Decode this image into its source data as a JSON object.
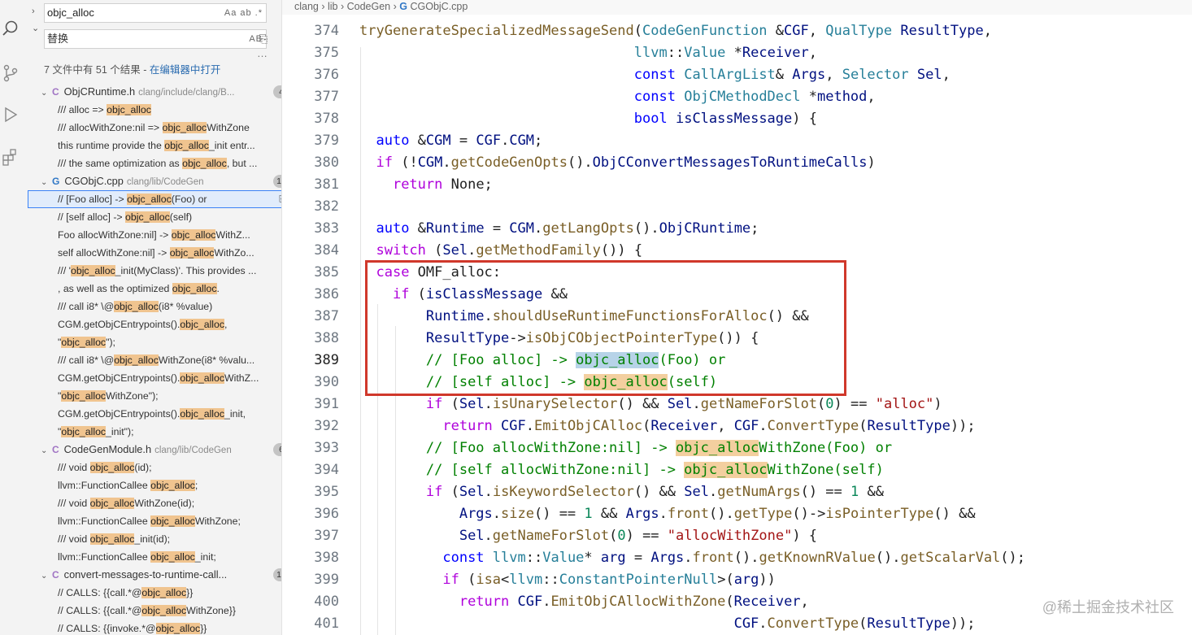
{
  "search": {
    "query": "objc_alloc",
    "replace_placeholder": "替换",
    "opts": "Aa ab .*",
    "replace_opt": "AB"
  },
  "summary": {
    "text": "7 文件中有 51 个结果 - ",
    "link": "在编辑器中打开"
  },
  "breadcrumb": [
    "clang",
    "lib",
    "CodeGen",
    "CGObjC.cpp"
  ],
  "results": [
    {
      "kind": "file",
      "icon": "C",
      "name": "ObjCRuntime.h",
      "path": "clang/include/clang/B...",
      "count": "4"
    },
    {
      "kind": "match",
      "pre": "///   alloc => ",
      "hit": "objc_alloc",
      "post": ""
    },
    {
      "kind": "match",
      "pre": "///   allocWithZone:nil => ",
      "hit": "objc_alloc",
      "post": "WithZone"
    },
    {
      "kind": "match",
      "pre": "this runtime provide the ",
      "hit": "objc_alloc",
      "post": "_init entr..."
    },
    {
      "kind": "match",
      "pre": "/// the same optimization as ",
      "hit": "objc_alloc",
      "post": ", but ..."
    },
    {
      "kind": "file",
      "icon": "G",
      "name": "CGObjC.cpp",
      "path": "clang/lib/CodeGen",
      "count": "14"
    },
    {
      "kind": "match",
      "selected": true,
      "pre": "// [Foo alloc] -> ",
      "hit": "objc_alloc",
      "post": "(Foo) or"
    },
    {
      "kind": "match",
      "pre": "// [self alloc] -> ",
      "hit": "objc_alloc",
      "post": "(self)"
    },
    {
      "kind": "match",
      "pre": "Foo allocWithZone:nil] -> ",
      "hit": "objc_alloc",
      "post": "WithZ..."
    },
    {
      "kind": "match",
      "pre": "self allocWithZone:nil] -> ",
      "hit": "objc_alloc",
      "post": "WithZo..."
    },
    {
      "kind": "match",
      "pre": "/// '",
      "hit": "objc_alloc",
      "post": "_init(MyClass)'. This provides ..."
    },
    {
      "kind": "match",
      "pre": ", as well as the optimized ",
      "hit": "objc_alloc",
      "post": "."
    },
    {
      "kind": "match",
      "pre": "///    call i8* \\@",
      "hit": "objc_alloc",
      "post": "(i8* %value)"
    },
    {
      "kind": "match",
      "pre": "CGM.getObjCEntrypoints().",
      "hit": "objc_alloc",
      "post": ","
    },
    {
      "kind": "match",
      "pre": "\"",
      "hit": "objc_alloc",
      "post": "\");"
    },
    {
      "kind": "match",
      "pre": "///    call i8* \\@",
      "hit": "objc_alloc",
      "post": "WithZone(i8* %valu..."
    },
    {
      "kind": "match",
      "pre": "CGM.getObjCEntrypoints().",
      "hit": "objc_alloc",
      "post": "WithZ..."
    },
    {
      "kind": "match",
      "pre": "\"",
      "hit": "objc_alloc",
      "post": "WithZone\");"
    },
    {
      "kind": "match",
      "pre": "CGM.getObjCEntrypoints().",
      "hit": "objc_alloc",
      "post": "_init,"
    },
    {
      "kind": "match",
      "pre": "\"",
      "hit": "objc_alloc",
      "post": "_init\");"
    },
    {
      "kind": "file",
      "icon": "C",
      "name": "CodeGenModule.h",
      "path": "clang/lib/CodeGen",
      "count": "6"
    },
    {
      "kind": "match",
      "pre": "/// void ",
      "hit": "objc_alloc",
      "post": "(id);"
    },
    {
      "kind": "match",
      "pre": "llvm::FunctionCallee ",
      "hit": "objc_alloc",
      "post": ";"
    },
    {
      "kind": "match",
      "pre": "/// void ",
      "hit": "objc_alloc",
      "post": "WithZone(id);"
    },
    {
      "kind": "match",
      "pre": "llvm::FunctionCallee ",
      "hit": "objc_alloc",
      "post": "WithZone;"
    },
    {
      "kind": "match",
      "pre": "/// void ",
      "hit": "objc_alloc",
      "post": "_init(id);"
    },
    {
      "kind": "match",
      "pre": "llvm::FunctionCallee ",
      "hit": "objc_alloc",
      "post": "_init;"
    },
    {
      "kind": "file",
      "icon": "C",
      "name": "convert-messages-to-runtime-call...",
      "path": "",
      "count": "13"
    },
    {
      "kind": "match",
      "pre": "// CALLS: {{call.*@",
      "hit": "objc_alloc",
      "post": "}}"
    },
    {
      "kind": "match",
      "pre": "// CALLS: {{call.*@",
      "hit": "objc_alloc",
      "post": "WithZone}}"
    },
    {
      "kind": "match",
      "pre": "// CALLS: {{invoke.*@",
      "hit": "objc_alloc",
      "post": "}}"
    }
  ],
  "editor": {
    "active_line": "389",
    "lines": [
      {
        "n": "374",
        "html": "<span class=\"fn\">tryGenerateSpecializedMessageSend</span>(<span class=\"ty\">CodeGenFunction</span> &amp;<span class=\"var\">CGF</span>, <span class=\"ty\">QualType</span> <span class=\"var\">ResultType</span>,"
      },
      {
        "n": "375",
        "html": "                                 <span class=\"ty\">llvm</span>::<span class=\"ty\">Value</span> *<span class=\"var\">Receiver</span>,"
      },
      {
        "n": "376",
        "html": "                                 <span class=\"kwb\">const</span> <span class=\"ty\">CallArgList</span>&amp; <span class=\"var\">Args</span>, <span class=\"ty\">Selector</span> <span class=\"var\">Sel</span>,"
      },
      {
        "n": "377",
        "html": "                                 <span class=\"kwb\">const</span> <span class=\"ty\">ObjCMethodDecl</span> *<span class=\"var\">method</span>,"
      },
      {
        "n": "378",
        "html": "                                 <span class=\"kwb\">bool</span> <span class=\"var\">isClassMessage</span>) {"
      },
      {
        "n": "379",
        "html": "  <span class=\"kwb\">auto</span> &amp;<span class=\"var\">CGM</span> = <span class=\"var\">CGF</span>.<span class=\"var\">CGM</span>;"
      },
      {
        "n": "380",
        "html": "  <span class=\"kw\">if</span> (!<span class=\"var\">CGM</span>.<span class=\"fn\">getCodeGenOpts</span>().<span class=\"var\">ObjCConvertMessagesToRuntimeCalls</span>)"
      },
      {
        "n": "381",
        "html": "    <span class=\"kw\">return</span> None;"
      },
      {
        "n": "382",
        "html": ""
      },
      {
        "n": "383",
        "html": "  <span class=\"kwb\">auto</span> &amp;<span class=\"var\">Runtime</span> = <span class=\"var\">CGM</span>.<span class=\"fn\">getLangOpts</span>().<span class=\"var\">ObjCRuntime</span>;"
      },
      {
        "n": "384",
        "html": "  <span class=\"kw\">switch</span> (<span class=\"var\">Sel</span>.<span class=\"fn\">getMethodFamily</span>()) {"
      },
      {
        "n": "385",
        "html": "  <span class=\"kw\">case</span> OMF_alloc:"
      },
      {
        "n": "386",
        "html": "    <span class=\"kw\">if</span> (<span class=\"var\">isClassMessage</span> &amp;&amp;"
      },
      {
        "n": "387",
        "html": "        <span class=\"var\">Runtime</span>.<span class=\"fn\">shouldUseRuntimeFunctionsForAlloc</span>() &amp;&amp;"
      },
      {
        "n": "388",
        "html": "        <span class=\"var\">ResultType</span>-&gt;<span class=\"fn\">isObjCObjectPointerType</span>()) {"
      },
      {
        "n": "389",
        "html": "        <span class=\"cm\">// [Foo alloc] -&gt; <span style=\"background:#b7d3e8\">objc_alloc</span>(Foo) or</span>"
      },
      {
        "n": "390",
        "html": "        <span class=\"cm\">// [self alloc] -&gt; <span style=\"background:#f3cf9f\">objc_alloc</span>(self)</span>"
      },
      {
        "n": "391",
        "html": "        <span class=\"kw\">if</span> (<span class=\"var\">Sel</span>.<span class=\"fn\">isUnarySelector</span>() &amp;&amp; <span class=\"var\">Sel</span>.<span class=\"fn\">getNameForSlot</span>(<span class=\"num\">0</span>) == <span class=\"str\">\"alloc\"</span>)"
      },
      {
        "n": "392",
        "html": "          <span class=\"kw\">return</span> <span class=\"var\">CGF</span>.<span class=\"fn\">EmitObjCAlloc</span>(<span class=\"var\">Receiver</span>, <span class=\"var\">CGF</span>.<span class=\"fn\">ConvertType</span>(<span class=\"var\">ResultType</span>));"
      },
      {
        "n": "393",
        "html": "        <span class=\"cm\">// [Foo allocWithZone:nil] -&gt; <span style=\"background:#f3cf9f\">objc_alloc</span>WithZone(Foo) or</span>"
      },
      {
        "n": "394",
        "html": "        <span class=\"cm\">// [self allocWithZone:nil] -&gt; <span style=\"background:#f3cf9f\">objc_alloc</span>WithZone(self)</span>"
      },
      {
        "n": "395",
        "html": "        <span class=\"kw\">if</span> (<span class=\"var\">Sel</span>.<span class=\"fn\">isKeywordSelector</span>() &amp;&amp; <span class=\"var\">Sel</span>.<span class=\"fn\">getNumArgs</span>() == <span class=\"num\">1</span> &amp;&amp;"
      },
      {
        "n": "396",
        "html": "            <span class=\"var\">Args</span>.<span class=\"fn\">size</span>() == <span class=\"num\">1</span> &amp;&amp; <span class=\"var\">Args</span>.<span class=\"fn\">front</span>().<span class=\"fn\">getType</span>()-&gt;<span class=\"fn\">isPointerType</span>() &amp;&amp;"
      },
      {
        "n": "397",
        "html": "            <span class=\"var\">Sel</span>.<span class=\"fn\">getNameForSlot</span>(<span class=\"num\">0</span>) == <span class=\"str\">\"allocWithZone\"</span>) {"
      },
      {
        "n": "398",
        "html": "          <span class=\"kwb\">const</span> <span class=\"ty\">llvm</span>::<span class=\"ty\">Value</span>* <span class=\"var\">arg</span> = <span class=\"var\">Args</span>.<span class=\"fn\">front</span>().<span class=\"fn\">getKnownRValue</span>().<span class=\"fn\">getScalarVal</span>();"
      },
      {
        "n": "399",
        "html": "          <span class=\"kw\">if</span> (<span class=\"fn\">isa</span>&lt;<span class=\"ty\">llvm</span>::<span class=\"ty\">ConstantPointerNull</span>&gt;(<span class=\"var\">arg</span>))"
      },
      {
        "n": "400",
        "html": "            <span class=\"kw\">return</span> <span class=\"var\">CGF</span>.<span class=\"fn\">EmitObjCAllocWithZone</span>(<span class=\"var\">Receiver</span>,"
      },
      {
        "n": "401",
        "html": "                                             <span class=\"var\">CGF</span>.<span class=\"fn\">ConvertType</span>(<span class=\"var\">ResultType</span>));"
      }
    ]
  },
  "watermark": "@稀土掘金技术社区"
}
